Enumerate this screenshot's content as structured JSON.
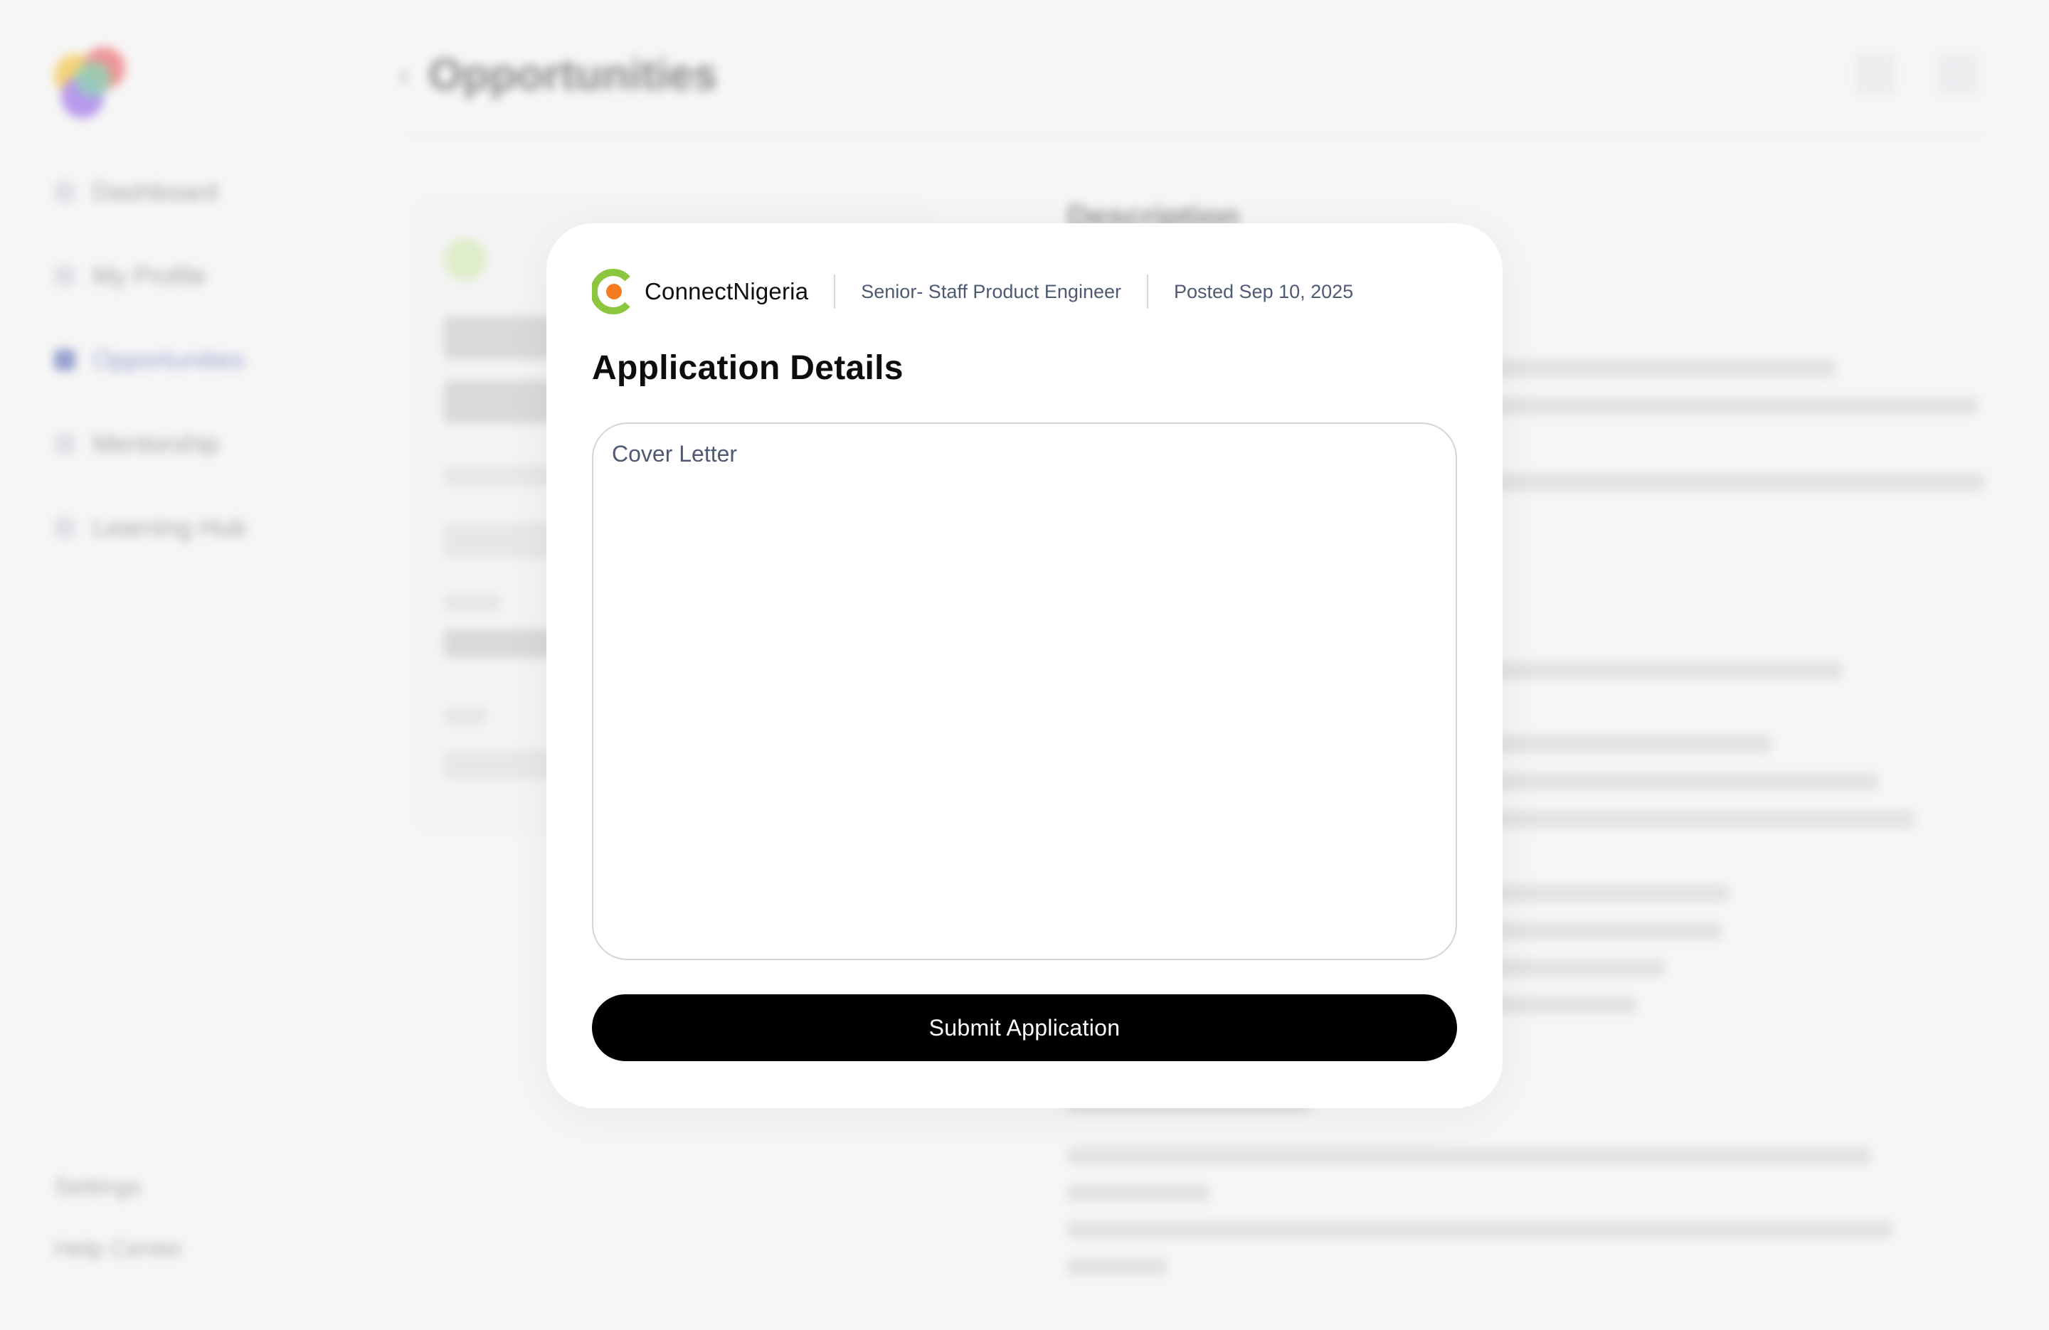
{
  "background": {
    "page_title": "Opportunities",
    "sidebar": {
      "items": [
        {
          "label": "Dashboard",
          "icon": "dashboard-icon"
        },
        {
          "label": "My Profile",
          "icon": "profile-icon"
        },
        {
          "label": "Opportunities",
          "icon": "opportunities-icon",
          "active": true
        },
        {
          "label": "Mentorship",
          "icon": "mentorship-icon"
        },
        {
          "label": "Learning Hub",
          "icon": "learning-icon"
        }
      ],
      "bottom": [
        "Settings",
        "Help Center"
      ]
    },
    "description_heading": "Description"
  },
  "modal": {
    "company": "ConnectNigeria",
    "job_title": "Senior- Staff Product Engineer",
    "posted": "Posted Sep 10, 2025",
    "heading": "Application Details",
    "cover_letter": {
      "placeholder": "Cover Letter",
      "value": ""
    },
    "submit_label": "Submit Application"
  },
  "colors": {
    "brand_green": "#8cc63f",
    "brand_orange": "#f47b20",
    "button_bg": "#000000",
    "muted_text": "#4e5a74"
  }
}
